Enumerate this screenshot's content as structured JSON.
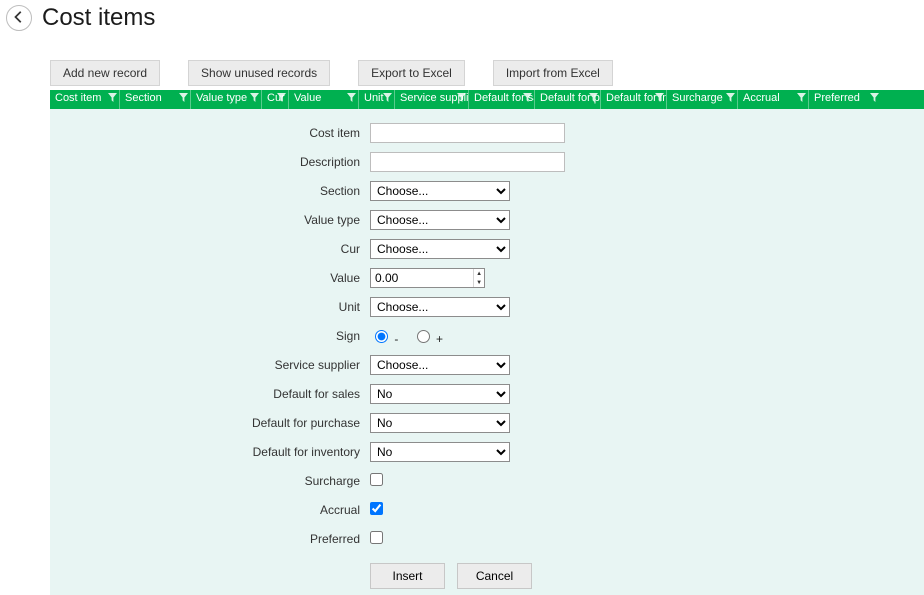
{
  "header": {
    "title": "Cost items"
  },
  "toolbar": {
    "add": "Add new record",
    "unused": "Show unused records",
    "export": "Export to Excel",
    "import": "Import from Excel"
  },
  "grid": {
    "cols": [
      {
        "label": "Cost item",
        "w": 70
      },
      {
        "label": "Section",
        "w": 71
      },
      {
        "label": "Value type",
        "w": 71
      },
      {
        "label": "Cur",
        "w": 27
      },
      {
        "label": "Value",
        "w": 70
      },
      {
        "label": "Unit",
        "w": 36
      },
      {
        "label": "Service supplier",
        "w": 74
      },
      {
        "label": "Default for sales",
        "w": 66
      },
      {
        "label": "Default for purchase",
        "w": 66
      },
      {
        "label": "Default for inventory",
        "w": 66
      },
      {
        "label": "Surcharge",
        "w": 71
      },
      {
        "label": "Accrual",
        "w": 71
      },
      {
        "label": "Preferred",
        "w": 72
      }
    ]
  },
  "form": {
    "labels": {
      "cost_item": "Cost item",
      "description": "Description",
      "section": "Section",
      "value_type": "Value type",
      "cur": "Cur",
      "value": "Value",
      "unit": "Unit",
      "sign": "Sign",
      "service_supplier": "Service supplier",
      "default_sales": "Default for sales",
      "default_purchase": "Default for purchase",
      "default_inventory": "Default for inventory",
      "surcharge": "Surcharge",
      "accrual": "Accrual",
      "preferred": "Preferred"
    },
    "values": {
      "cost_item": "",
      "description": "",
      "section": "Choose...",
      "value_type": "Choose...",
      "cur": "Choose...",
      "value": "0.00",
      "unit": "Choose...",
      "sign_minus": "-",
      "sign_plus": "+",
      "service_supplier": "Choose...",
      "default_sales": "No",
      "default_purchase": "No",
      "default_inventory": "No",
      "surcharge": false,
      "accrual": true,
      "preferred": false
    },
    "buttons": {
      "insert": "Insert",
      "cancel": "Cancel"
    }
  }
}
